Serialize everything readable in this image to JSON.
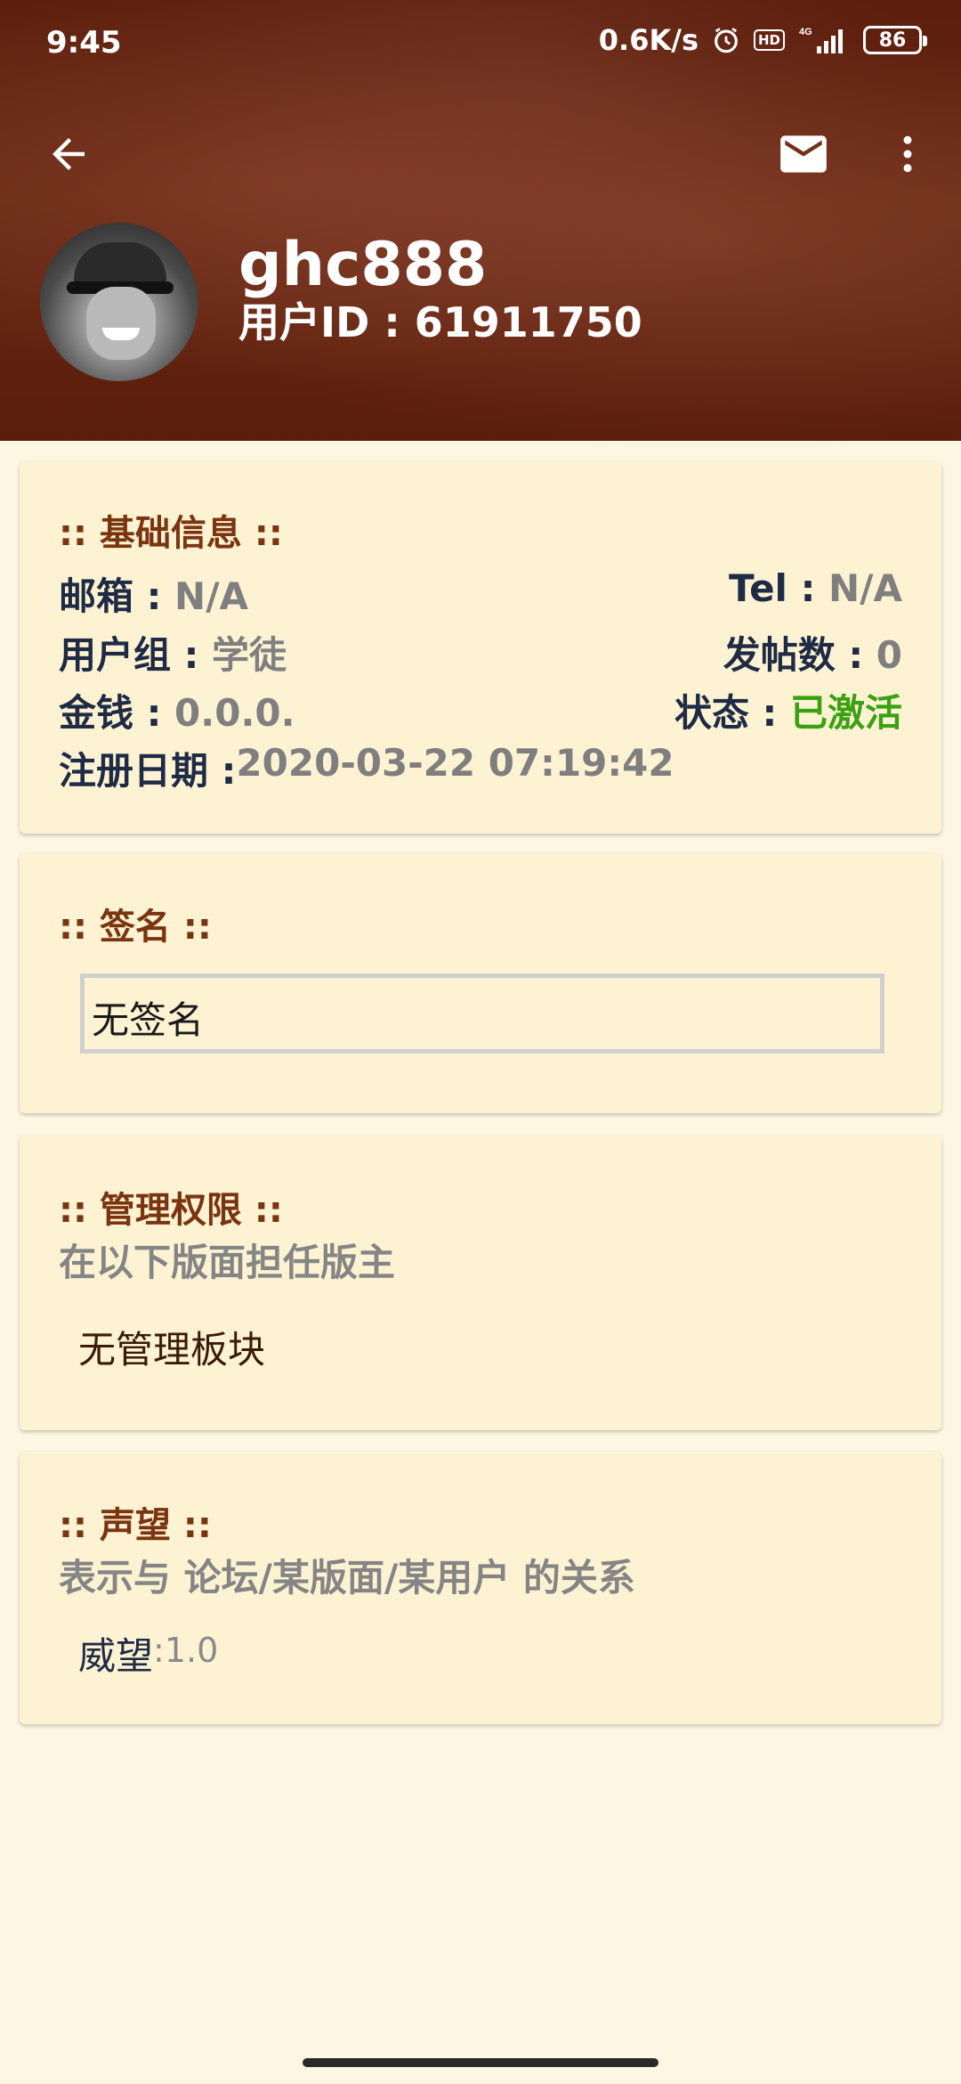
{
  "status_bar": {
    "time": "9:45",
    "net_speed": "0.6K/s",
    "hd": "HD",
    "signal_label": "4G",
    "battery": "86"
  },
  "header": {
    "username": "ghc888",
    "user_id": "用户ID : 61911750"
  },
  "basic_info": {
    "title": ":: 基础信息 ::",
    "email_label": "邮箱 : ",
    "email_value": "N/A",
    "tel_label": "Tel : ",
    "tel_value": "N/A",
    "group_label": "用户组 : ",
    "group_value": "学徒",
    "posts_label": "发帖数 : ",
    "posts_value": "0",
    "money_label": "金钱 : ",
    "money_value": "0.0.0.",
    "status_label": "状态 : ",
    "status_value": "已激活",
    "reg_label": "注册日期 : ",
    "reg_value": "2020-03-22 07:19:42"
  },
  "signature": {
    "title": ":: 签名 ::",
    "value": "无签名"
  },
  "admin": {
    "title": ":: 管理权限 ::",
    "subtitle": "在以下版面担任版主",
    "value": "无管理板块"
  },
  "reputation": {
    "title": ":: 声望 ::",
    "subtitle": "表示与 论坛/某版面/某用户 的关系",
    "label": "威望",
    "value": ":1.0"
  },
  "colors": {
    "header_bg": "#5c1e0c",
    "page_bg": "#fdf6e3",
    "card_bg": "#fdf3d3",
    "title_color": "#7a3410",
    "active_green": "#39a112"
  }
}
